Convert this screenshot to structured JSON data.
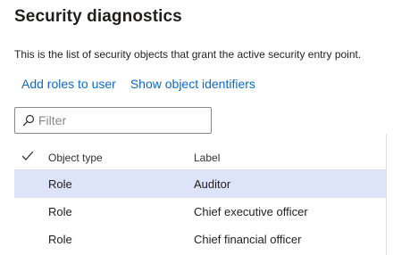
{
  "page": {
    "title": "Security diagnostics",
    "description": "This is the list of security objects that grant the active security entry point."
  },
  "actions": {
    "add_roles": "Add roles to user",
    "show_identifiers": "Show object identifiers"
  },
  "filter": {
    "placeholder": "Filter",
    "value": "",
    "icon": "search-icon"
  },
  "grid": {
    "columns": [
      "Object type",
      "Label"
    ],
    "rows": [
      {
        "type": "Role",
        "label": "Auditor",
        "selected": true
      },
      {
        "type": "Role",
        "label": "Chief executive officer",
        "selected": false
      },
      {
        "type": "Role",
        "label": "Chief financial officer",
        "selected": false
      }
    ]
  },
  "colors": {
    "link": "#0f6cbd",
    "selected_row": "#dde3f8",
    "border": "#8a8886"
  }
}
